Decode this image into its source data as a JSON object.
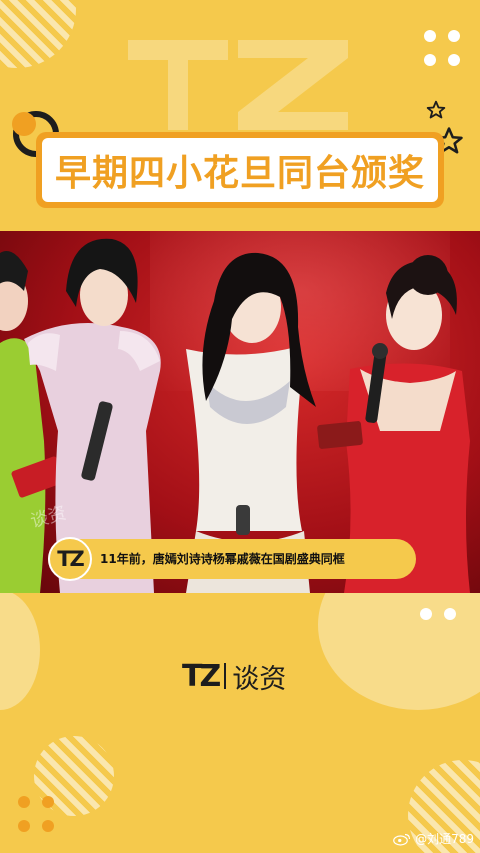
{
  "title": "早期四小花旦同台颁奖",
  "subtitle": {
    "logo": "TZ",
    "text": "11年前，唐嫣刘诗诗杨幂戚薇在国剧盛典同框"
  },
  "photo_watermark": "谈资",
  "brand": {
    "logo": "TZ",
    "name": "谈资"
  },
  "weibo_handle": "@刘通789",
  "colors": {
    "background": "#f5c94c",
    "accent": "#f0a022",
    "stage": "#a20f16"
  }
}
